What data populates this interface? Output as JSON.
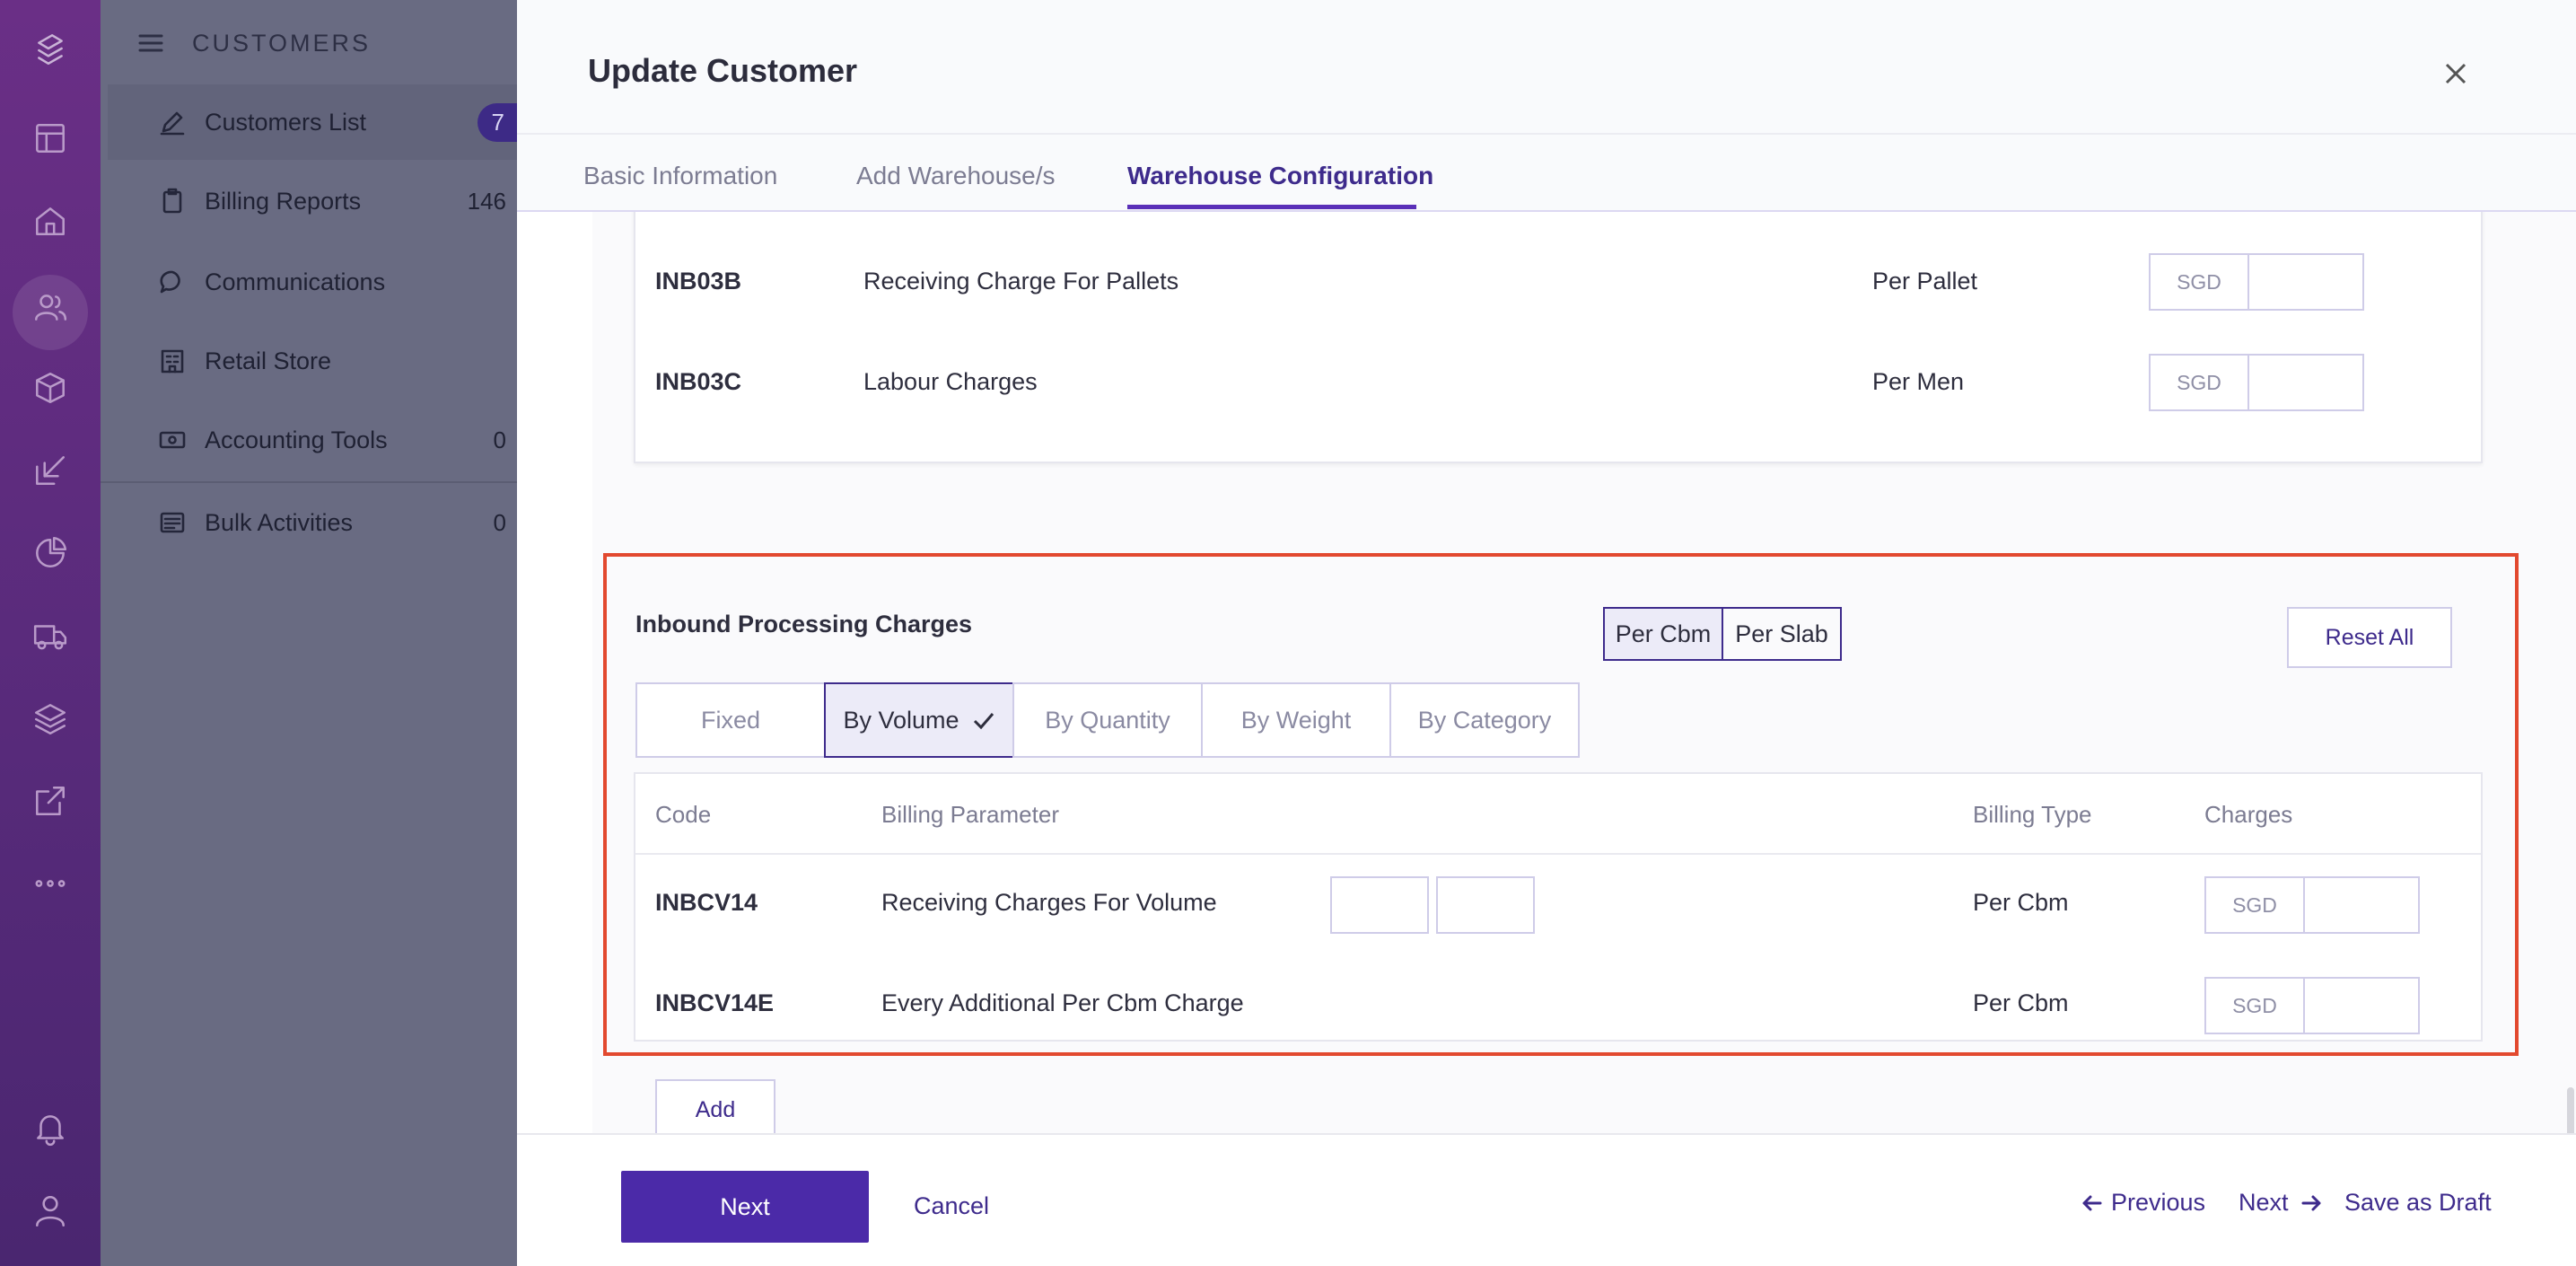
{
  "sidebar": {
    "section_title": "CUSTOMERS",
    "items": [
      {
        "label": "Customers List",
        "count": "7"
      },
      {
        "label": "Billing Reports",
        "count": "146"
      },
      {
        "label": "Communications",
        "count": ""
      },
      {
        "label": "Retail Store",
        "count": ""
      },
      {
        "label": "Accounting Tools",
        "count": "0"
      },
      {
        "label": "Bulk Activities",
        "count": "0"
      }
    ]
  },
  "rail_icons": [
    "logo-icon",
    "dashboard-icon",
    "home-icon",
    "customers-icon",
    "box-icon",
    "inbound-icon",
    "reports-icon",
    "truck-icon",
    "layers-icon",
    "external-icon",
    "more-icon",
    "bell-icon",
    "user-icon"
  ],
  "modal": {
    "title": "Update Customer",
    "tabs": [
      {
        "label": "Basic Information",
        "active": false
      },
      {
        "label": "Add Warehouse/s",
        "active": false
      },
      {
        "label": "Warehouse Configuration",
        "active": true
      }
    ]
  },
  "top_card": {
    "rows": [
      {
        "code": "INB03B",
        "parameter": "Receiving Charge For Pallets",
        "billing_type": "Per Pallet",
        "currency": "SGD",
        "value": ""
      },
      {
        "code": "INB03C",
        "parameter": "Labour Charges",
        "billing_type": "Per Men",
        "currency": "SGD",
        "value": ""
      }
    ]
  },
  "inbound": {
    "title": "Inbound Processing Charges",
    "unit_toggle": [
      {
        "label": "Per Cbm",
        "selected": true
      },
      {
        "label": "Per Slab",
        "selected": false
      }
    ],
    "reset_label": "Reset All",
    "options": [
      {
        "label": "Fixed",
        "selected": false
      },
      {
        "label": "By Volume",
        "selected": true
      },
      {
        "label": "By Quantity",
        "selected": false
      },
      {
        "label": "By Weight",
        "selected": false
      },
      {
        "label": "By Category",
        "selected": false
      }
    ],
    "headers": {
      "code": "Code",
      "parameter": "Billing Parameter",
      "billing_type": "Billing Type",
      "charges": "Charges"
    },
    "rows": [
      {
        "code": "INBCV14",
        "parameter": "Receiving Charges For Volume",
        "billing_type": "Per Cbm",
        "currency": "SGD",
        "value": ""
      },
      {
        "code": "INBCV14E",
        "parameter": "Every Additional Per Cbm Charge",
        "billing_type": "Per Cbm",
        "currency": "SGD",
        "value": ""
      }
    ],
    "add_label": "Add"
  },
  "footer": {
    "next_label": "Next",
    "cancel_label": "Cancel",
    "previous_label": "Previous",
    "next_link_label": "Next",
    "save_draft_label": "Save as Draft"
  },
  "colors": {
    "accent": "#4b2aa8",
    "highlight": "#e2492f",
    "rail": "#5a2b7c"
  }
}
